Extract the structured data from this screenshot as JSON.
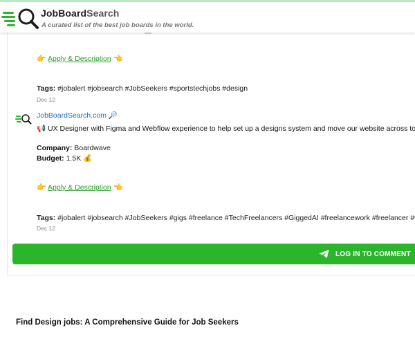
{
  "site": {
    "brand_job": "JobBoard",
    "brand_search": "Search",
    "tagline": "A curated list of the best job boards in the world."
  },
  "post_prev": {
    "apply_label": "Apply & Description",
    "tags_label": "Tags:",
    "tags": "#jobalert #jobsearch #JobSeekers #sportstechjobs #design",
    "date": "Dec 12"
  },
  "post": {
    "author": "JobBoardSearch.com",
    "author_emoji": "🔎",
    "title_emoji": "📢",
    "title": "UX Designer with Figma and Webflow experience to help set up a designs system and move our website across to W",
    "company_label": "Company:",
    "company": "Boardwave",
    "budget_label": "Budget:",
    "budget": "1.5K",
    "budget_emoji": "💰",
    "apply_label": "Apply & Description",
    "tags_label": "Tags:",
    "tags": "#jobalert #jobsearch #JobSeekers #gigs #freelance #TechFreelancers #GiggedAI #freelancework #freelancer #w",
    "date": "Dec 12"
  },
  "login": {
    "label": "LOG IN TO COMMENT"
  },
  "guide": {
    "title": "Find Design jobs: A Comprehensive Guide for Job Seekers"
  },
  "colors": {
    "accent_green": "#2bb52b",
    "link_blue": "#2a6eb6",
    "apply_green": "#2a9a2a"
  }
}
